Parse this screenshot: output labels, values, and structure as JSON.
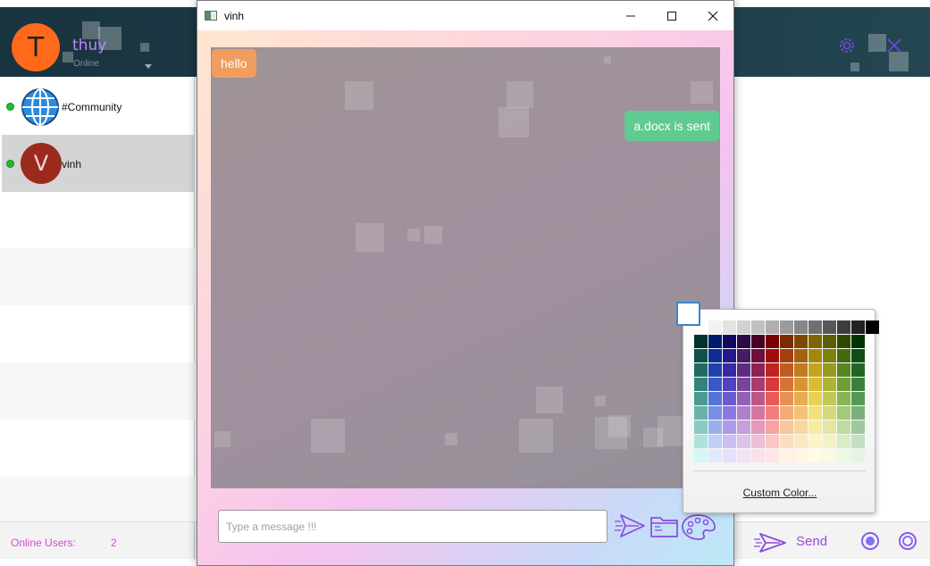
{
  "app": {
    "user_initial": "T",
    "user_name": "thuy",
    "user_status": "Online",
    "contacts": [
      {
        "name": "#Community",
        "online": true
      },
      {
        "name": "vinh",
        "initial": "V",
        "online": true
      }
    ],
    "online_users_label": "Online Users:",
    "online_users_count": "2",
    "send_label": "Send"
  },
  "chat_window": {
    "title": "vinh",
    "messages": [
      {
        "text": "hello",
        "direction": "incoming",
        "color": "#f09d5e"
      },
      {
        "text": "a.docx is sent",
        "direction": "outgoing",
        "color": "#60cb91"
      }
    ],
    "input_placeholder": "Type a message !!!"
  },
  "color_picker": {
    "custom_color_label": "Custom Color...",
    "current_color": "#ffffff",
    "grey_row": [
      "#ffffff",
      "#f2f2f2",
      "#e3e3e3",
      "#d2d2d2",
      "#c1c1c1",
      "#afafaf",
      "#9b9b9b",
      "#868686",
      "#707070",
      "#575757",
      "#3d3d3d",
      "#222222",
      "#000000"
    ],
    "columns": [
      [
        "#00332e",
        "#10504a",
        "#226a63",
        "#33837b",
        "#4a9b93",
        "#6ab2aa",
        "#8ccbc3",
        "#afe2dc",
        "#d3f7f3"
      ],
      [
        "#001b6e",
        "#0d2d93",
        "#2041ad",
        "#3858c3",
        "#5673d6",
        "#7790e4",
        "#9ab0ee",
        "#bfcff6",
        "#e1eafd"
      ],
      [
        "#100a5e",
        "#23198a",
        "#3828a6",
        "#5140bf",
        "#6c5ad2",
        "#8b79df",
        "#ab9ae9",
        "#cabef3",
        "#e7e0fb"
      ],
      [
        "#2e0a45",
        "#461a66",
        "#5e2b84",
        "#7a43a0",
        "#9460b6",
        "#ae7fca",
        "#c89fdb",
        "#dec2ea",
        "#f2e2f6"
      ],
      [
        "#4a0026",
        "#6e0e3d",
        "#8c2256",
        "#a73a6e",
        "#bd5786",
        "#d2779f",
        "#e39aba",
        "#f0bed5",
        "#fae0ec"
      ],
      [
        "#7a0000",
        "#a10d0d",
        "#bf2222",
        "#d73a3a",
        "#e85a5a",
        "#f27d7d",
        "#f8a2a2",
        "#fdc6c6",
        "#ffe5e5"
      ],
      [
        "#7e2a00",
        "#a4400d",
        "#c05a20",
        "#d67437",
        "#e69256",
        "#f0ad7a",
        "#f7c79e",
        "#fcdec3",
        "#fff1e4"
      ],
      [
        "#7e4800",
        "#a5620d",
        "#c27b1e",
        "#d89434",
        "#e8ac52",
        "#f2c377",
        "#f8d79c",
        "#fde8c2",
        "#fff6e4"
      ],
      [
        "#7e6500",
        "#a6870d",
        "#c3a41e",
        "#d9bb35",
        "#e8cf55",
        "#f3e07a",
        "#f9eb9f",
        "#fdf4c4",
        "#fffbe5"
      ],
      [
        "#5c5e00",
        "#7c800d",
        "#979b20",
        "#aeb338",
        "#c2c756",
        "#d5d97b",
        "#e4e79f",
        "#f1f3c4",
        "#fafbe4"
      ],
      [
        "#2e4a00",
        "#436a0d",
        "#578520",
        "#6e9e38",
        "#88b456",
        "#a3c97b",
        "#bedca0",
        "#d8edc5",
        "#eef8e5"
      ],
      [
        "#003300",
        "#0e4d14",
        "#226627",
        "#3a7f3e",
        "#579859",
        "#79b07a",
        "#9ec89e",
        "#c3e0c3",
        "#e4f5e4"
      ]
    ]
  }
}
